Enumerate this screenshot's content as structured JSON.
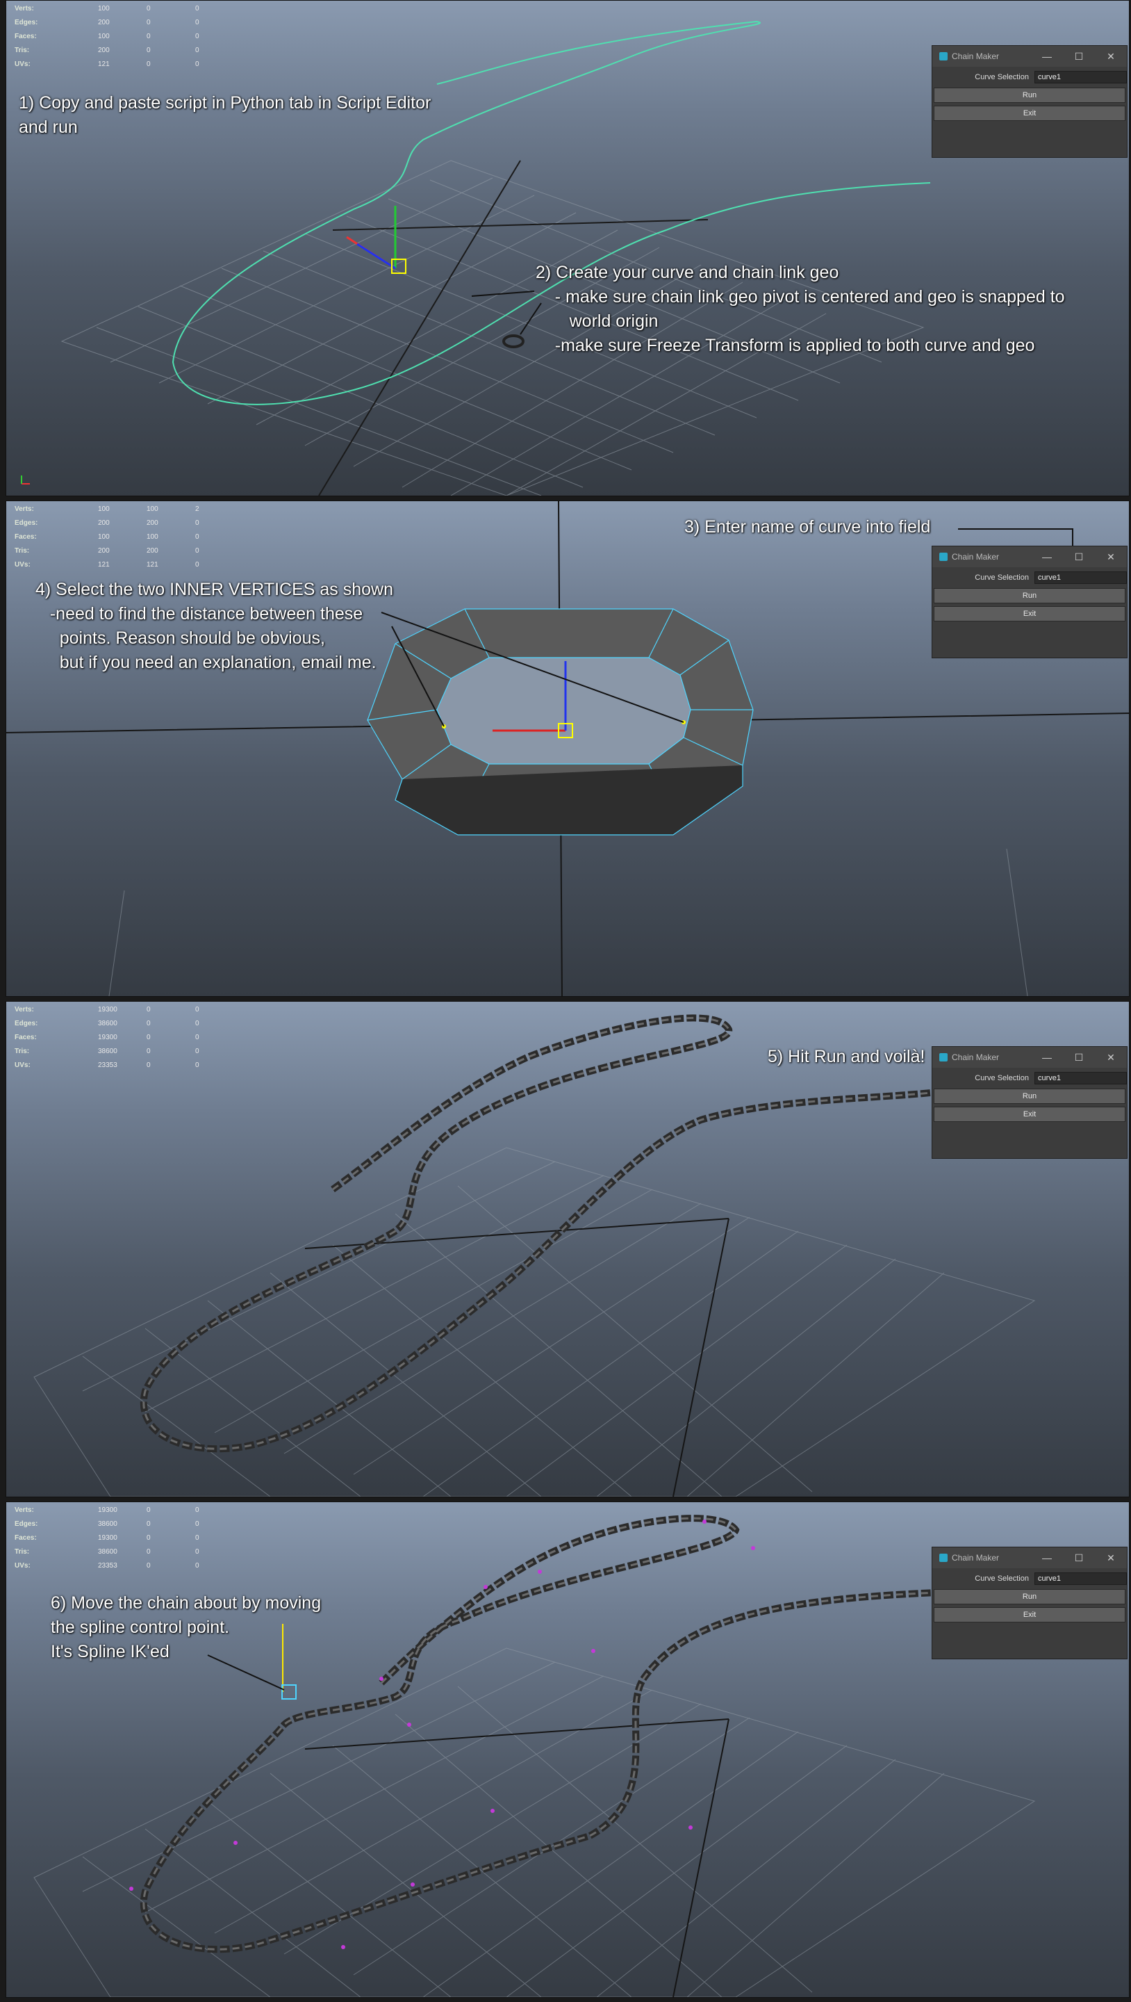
{
  "hud_labels": [
    "Verts:",
    "Edges:",
    "Faces:",
    "Tris:",
    "UVs:"
  ],
  "panels": [
    {
      "hud": [
        [
          "100",
          "0",
          "0"
        ],
        [
          "200",
          "0",
          "0"
        ],
        [
          "100",
          "0",
          "0"
        ],
        [
          "200",
          "0",
          "0"
        ],
        [
          "121",
          "0",
          "0"
        ]
      ],
      "annotations": [
        "1) Copy and paste script in Python tab in Script Editor\nand run",
        "2) Create your curve and chain link geo\n    - make sure chain link geo pivot is centered and geo is snapped to\n       world origin\n    -make sure Freeze Transform is applied to both curve and geo"
      ]
    },
    {
      "hud": [
        [
          "100",
          "100",
          "2"
        ],
        [
          "200",
          "200",
          "0"
        ],
        [
          "100",
          "100",
          "0"
        ],
        [
          "200",
          "200",
          "0"
        ],
        [
          "121",
          "121",
          "0"
        ]
      ],
      "annotations": [
        "3) Enter name of curve into field",
        "4) Select the two INNER VERTICES as shown\n   -need to find the distance between these\n     points. Reason should be obvious,\n     but if you need an explanation, email me."
      ]
    },
    {
      "hud": [
        [
          "19300",
          "0",
          "0"
        ],
        [
          "38600",
          "0",
          "0"
        ],
        [
          "19300",
          "0",
          "0"
        ],
        [
          "38600",
          "0",
          "0"
        ],
        [
          "23353",
          "0",
          "0"
        ]
      ],
      "annotations": [
        "5) Hit Run and voilà!"
      ]
    },
    {
      "hud": [
        [
          "19300",
          "0",
          "0"
        ],
        [
          "38600",
          "0",
          "0"
        ],
        [
          "19300",
          "0",
          "0"
        ],
        [
          "38600",
          "0",
          "0"
        ],
        [
          "23353",
          "0",
          "0"
        ]
      ],
      "annotations": [
        "6) Move the chain about by moving\nthe spline control point.\nIt's Spline IK'ed"
      ]
    }
  ],
  "dialog": {
    "title": "Chain Maker",
    "minimize": "—",
    "maximize": "☐",
    "close": "✕",
    "field_label": "Curve Selection",
    "field_value": "curve1",
    "run_label": "Run",
    "exit_label": "Exit"
  },
  "colors": {
    "curve": "#4fe0b0",
    "chain": "#4a4a4a",
    "wire": "#4fd5ff",
    "grid": "#9aa3ad"
  }
}
